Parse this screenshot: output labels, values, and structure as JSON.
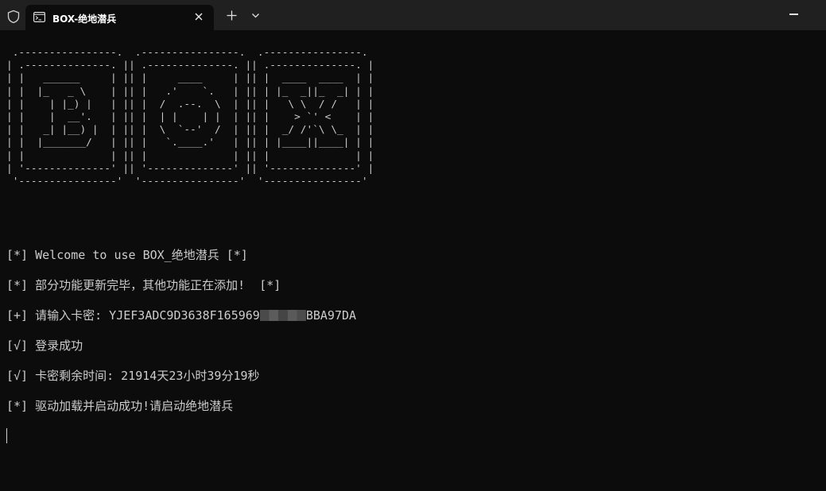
{
  "window": {
    "tab_title": "BOX-绝地潜兵",
    "icons": [
      "shield-icon",
      "terminal-icon",
      "close-icon",
      "plus-icon",
      "chevron-down-icon",
      "minimize-icon"
    ]
  },
  "terminal": {
    "ascii_banner": " .----------------.  .----------------.  .----------------. \n| .--------------. || .--------------. || .--------------. |\n| |   ______     | || |     ____     | || |  ____  ____  | |\n| |  |_   _ \\    | || |   .'    `.   | || | |_  _||_  _| | |\n| |    | |_) |   | || |  /  .--.  \\  | || |   \\ \\  / /   | |\n| |    |  __'.   | || |  | |    | |  | || |    > `' <    | |\n| |   _| |__) |  | || |  \\  `--'  /  | || |  _/ /'`\\ \\_  | |\n| |  |_______/   | || |   `.____.'   | || | |____||____| | |\n| |              | || |              | || |              | |\n| '--------------' || '--------------' || '--------------' |\n '----------------'  '----------------'  '----------------' ",
    "lines": [
      "[*] Welcome to use BOX_绝地潜兵 [*]",
      "[*] 部分功能更新完毕，其他功能正在添加!  [*]",
      "[+] 请输入卡密: YJEF3ADC9D3638F165969",
      "[√] 登录成功",
      "[√] 卡密剩余时间: 21914天23小时39分19秒",
      "[*] 驱动加载并启动成功!请启动绝地潜兵"
    ],
    "license_key_suffix": "BBA97DA"
  }
}
